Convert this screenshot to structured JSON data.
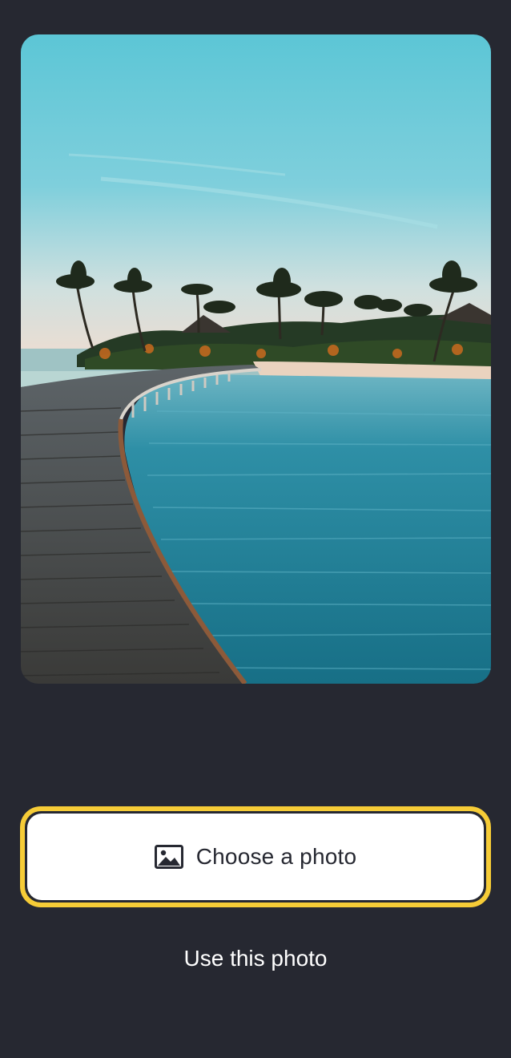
{
  "photo": {
    "subject": "beach-boardwalk-photo"
  },
  "actions": {
    "choose_photo_label": "Choose a photo",
    "choose_photo_icon": "image-icon",
    "use_photo_label": "Use this photo"
  },
  "colors": {
    "background": "#262831",
    "focus_ring": "#f6cc37",
    "button_fill": "#ffffff"
  }
}
